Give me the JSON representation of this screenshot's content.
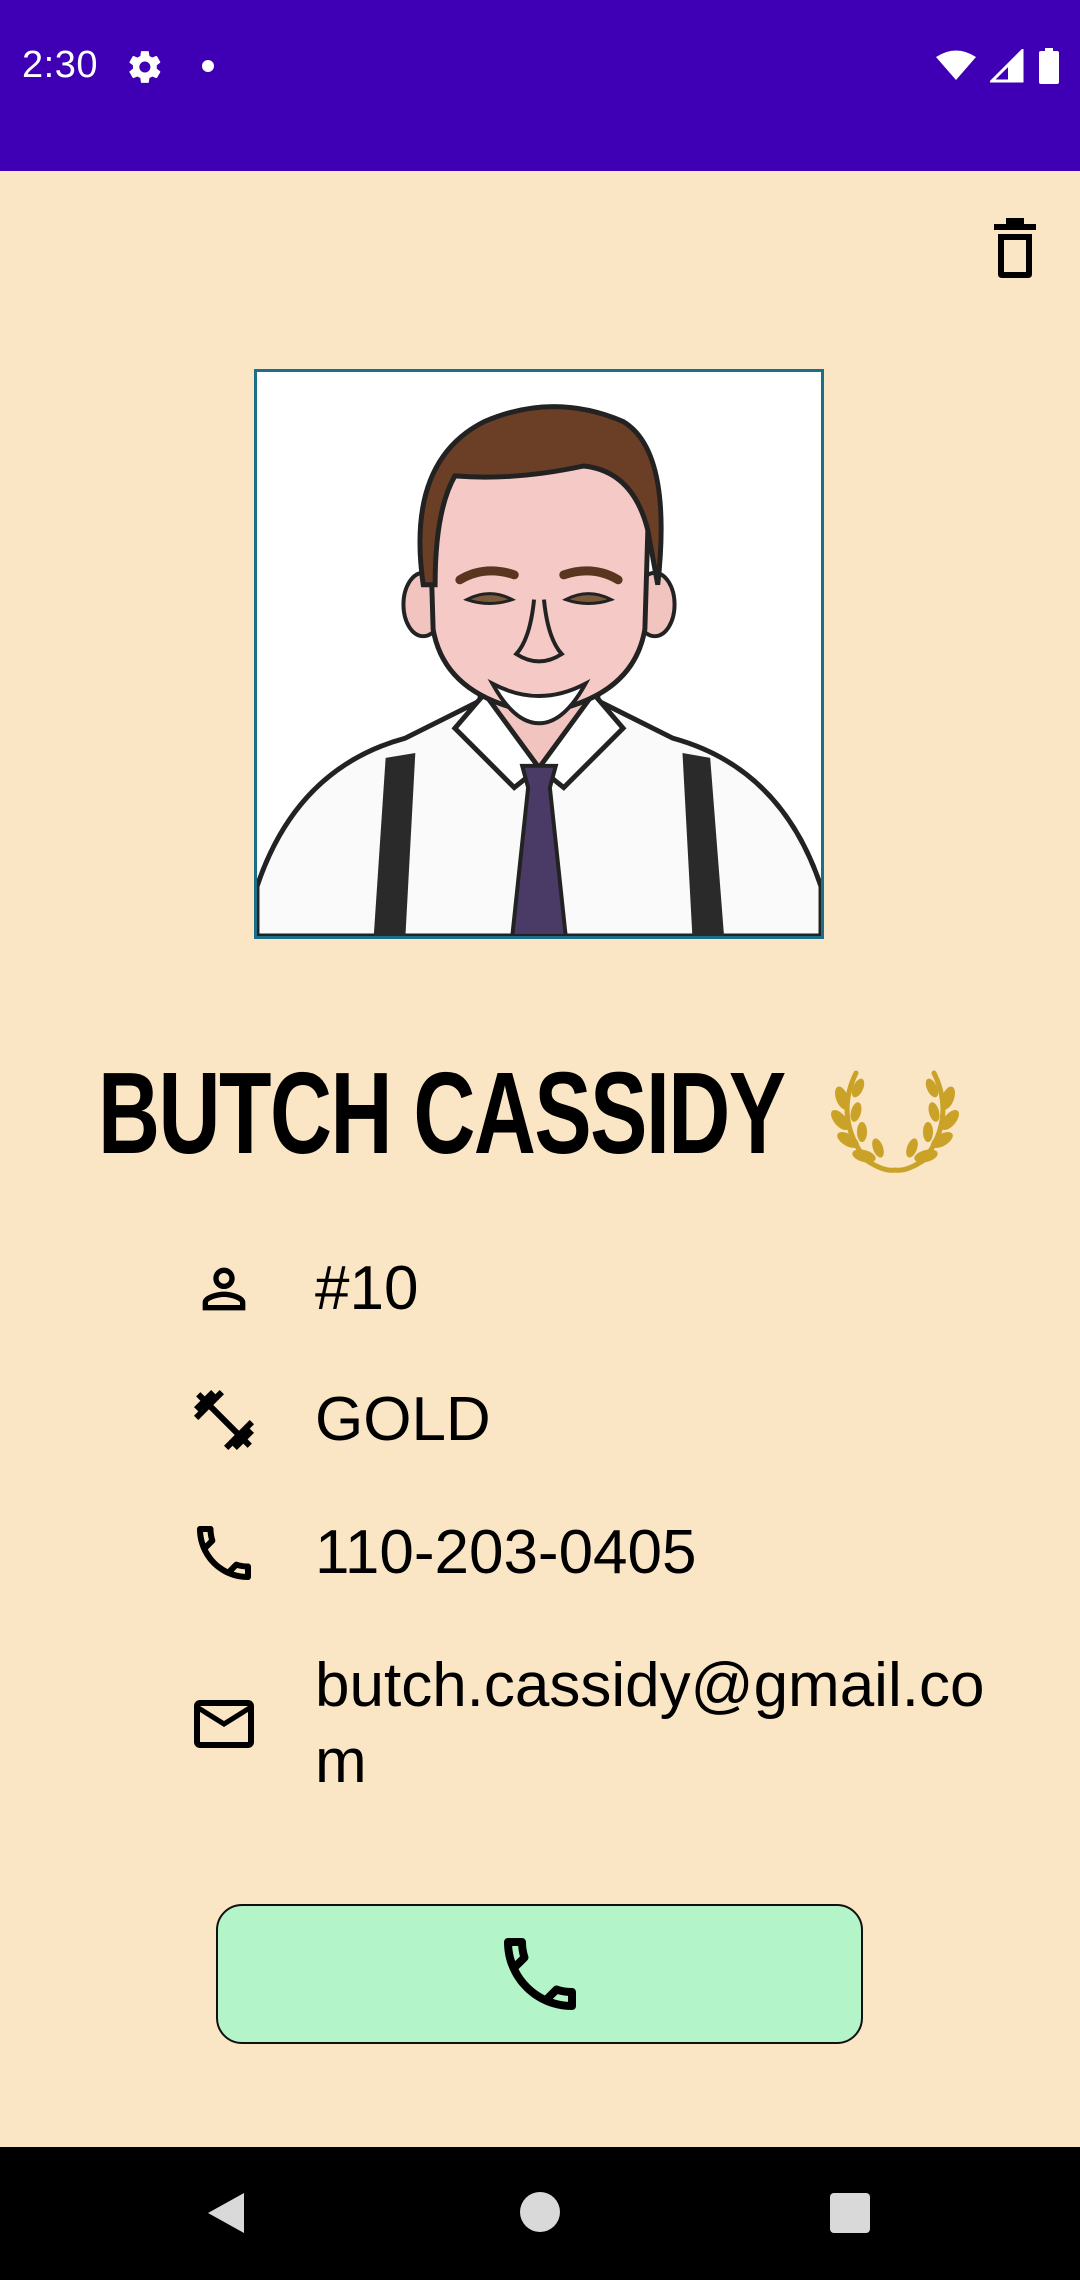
{
  "status_bar": {
    "time": "2:30",
    "icons": [
      "settings-icon",
      "notification-dot-icon",
      "wifi-icon",
      "signal-icon",
      "battery-icon"
    ],
    "background": "#3f00b5"
  },
  "toolbar": {
    "delete_icon": "trash-icon"
  },
  "profile": {
    "photo_icon": "avatar-illustration",
    "name": "BUTCH CASSIDY",
    "badge_icon": "laurel-wreath-icon",
    "badge_color": "#c9a227"
  },
  "details": [
    {
      "icon": "person-icon",
      "value": "#10"
    },
    {
      "icon": "dumbbell-icon",
      "value": "GOLD"
    },
    {
      "icon": "phone-icon",
      "value": "110-203-0405"
    },
    {
      "icon": "mail-icon",
      "value": "butch.cassidy@gmail.com"
    }
  ],
  "actions": {
    "call_icon": "phone-icon",
    "call_color": "#b3f5c8"
  },
  "nav_bar": {
    "icons": [
      "back-icon",
      "home-icon",
      "recents-icon"
    ]
  },
  "colors": {
    "background": "#fae5c5",
    "photo_border": "#1c6f8a"
  }
}
